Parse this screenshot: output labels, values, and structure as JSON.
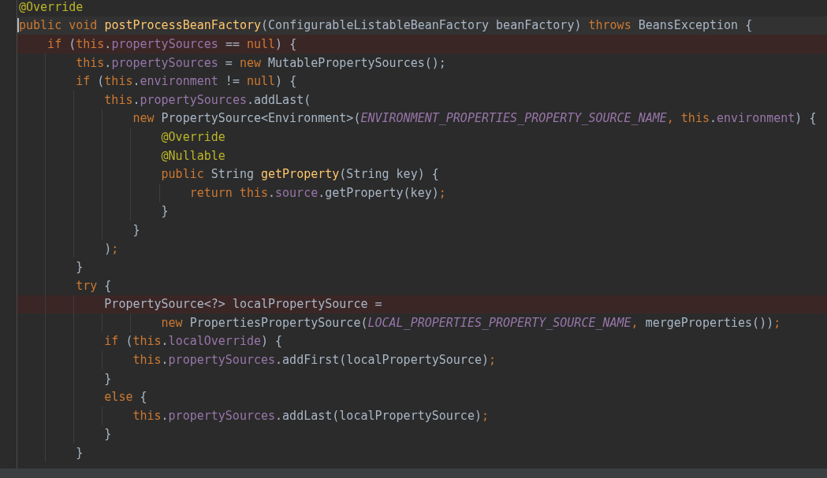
{
  "editor": {
    "lines": [
      {
        "kind": "normal",
        "tokens": [
          {
            "kind": "annotation",
            "text": "@Override"
          }
        ]
      },
      {
        "kind": "current",
        "tokens": [
          {
            "kind": "keyword",
            "text": "public void "
          },
          {
            "kind": "method",
            "text": "postProcessBeanFactory"
          },
          {
            "kind": "plain",
            "text": "(ConfigurableListableBeanFactory beanFactory) "
          },
          {
            "kind": "keyword",
            "text": "throws "
          },
          {
            "kind": "plain",
            "text": "BeansException {"
          }
        ]
      },
      {
        "kind": "marked",
        "tokens": [
          {
            "kind": "keyword",
            "text": "    if "
          },
          {
            "kind": "plain",
            "text": "("
          },
          {
            "kind": "keyword",
            "text": "this"
          },
          {
            "kind": "plain",
            "text": "."
          },
          {
            "kind": "field",
            "text": "propertySources"
          },
          {
            "kind": "plain",
            "text": " == "
          },
          {
            "kind": "keyword",
            "text": "null"
          },
          {
            "kind": "plain",
            "text": ") {"
          }
        ]
      },
      {
        "kind": "normal",
        "tokens": [
          {
            "kind": "keyword",
            "text": "        this"
          },
          {
            "kind": "plain",
            "text": "."
          },
          {
            "kind": "field",
            "text": "propertySources"
          },
          {
            "kind": "plain",
            "text": " = "
          },
          {
            "kind": "keyword",
            "text": "new "
          },
          {
            "kind": "plain",
            "text": "MutablePropertySources();"
          }
        ]
      },
      {
        "kind": "normal",
        "tokens": [
          {
            "kind": "keyword",
            "text": "        if "
          },
          {
            "kind": "plain",
            "text": "("
          },
          {
            "kind": "keyword",
            "text": "this"
          },
          {
            "kind": "plain",
            "text": "."
          },
          {
            "kind": "field",
            "text": "environment"
          },
          {
            "kind": "plain",
            "text": " != "
          },
          {
            "kind": "keyword",
            "text": "null"
          },
          {
            "kind": "plain",
            "text": ") {"
          }
        ]
      },
      {
        "kind": "normal",
        "tokens": [
          {
            "kind": "keyword",
            "text": "            this"
          },
          {
            "kind": "plain",
            "text": "."
          },
          {
            "kind": "field",
            "text": "propertySources"
          },
          {
            "kind": "plain",
            "text": ".addLast("
          }
        ]
      },
      {
        "kind": "normal",
        "tokens": [
          {
            "kind": "keyword",
            "text": "                new "
          },
          {
            "kind": "plain",
            "text": "PropertySource<Environment>("
          },
          {
            "kind": "constant",
            "text": "ENVIRONMENT_PROPERTIES_PROPERTY_SOURCE_NAME"
          },
          {
            "kind": "keyword",
            "text": ", this"
          },
          {
            "kind": "plain",
            "text": "."
          },
          {
            "kind": "field",
            "text": "environment"
          },
          {
            "kind": "plain",
            "text": ") {"
          }
        ]
      },
      {
        "kind": "normal",
        "tokens": [
          {
            "kind": "annotation",
            "text": "                    @Override"
          }
        ]
      },
      {
        "kind": "normal",
        "tokens": [
          {
            "kind": "annotation",
            "text": "                    @Nullable"
          }
        ]
      },
      {
        "kind": "normal",
        "tokens": [
          {
            "kind": "keyword",
            "text": "                    public "
          },
          {
            "kind": "plain",
            "text": "String "
          },
          {
            "kind": "method",
            "text": "getProperty"
          },
          {
            "kind": "plain",
            "text": "(String key) {"
          }
        ]
      },
      {
        "kind": "normal",
        "tokens": [
          {
            "kind": "keyword",
            "text": "                        return this"
          },
          {
            "kind": "plain",
            "text": "."
          },
          {
            "kind": "field",
            "text": "source"
          },
          {
            "kind": "plain",
            "text": ".getProperty(key)"
          },
          {
            "kind": "keyword",
            "text": ";"
          }
        ]
      },
      {
        "kind": "normal",
        "tokens": [
          {
            "kind": "plain",
            "text": "                    }"
          }
        ]
      },
      {
        "kind": "normal",
        "tokens": [
          {
            "kind": "plain",
            "text": "                }"
          }
        ]
      },
      {
        "kind": "normal",
        "tokens": [
          {
            "kind": "plain",
            "text": "            )"
          },
          {
            "kind": "keyword",
            "text": ";"
          }
        ]
      },
      {
        "kind": "normal",
        "tokens": [
          {
            "kind": "plain",
            "text": "        }"
          }
        ]
      },
      {
        "kind": "normal",
        "tokens": [
          {
            "kind": "keyword",
            "text": "        try "
          },
          {
            "kind": "plain",
            "text": "{"
          }
        ]
      },
      {
        "kind": "marked",
        "tokens": [
          {
            "kind": "plain",
            "text": "            PropertySource<?> localPropertySource ="
          }
        ]
      },
      {
        "kind": "normal",
        "tokens": [
          {
            "kind": "keyword",
            "text": "                    new "
          },
          {
            "kind": "plain",
            "text": "PropertiesPropertySource("
          },
          {
            "kind": "constant",
            "text": "LOCAL_PROPERTIES_PROPERTY_SOURCE_NAME"
          },
          {
            "kind": "keyword",
            "text": ", "
          },
          {
            "kind": "plain",
            "text": "mergeProperties())"
          },
          {
            "kind": "keyword",
            "text": ";"
          }
        ]
      },
      {
        "kind": "normal",
        "tokens": [
          {
            "kind": "keyword",
            "text": "            if "
          },
          {
            "kind": "plain",
            "text": "("
          },
          {
            "kind": "keyword",
            "text": "this"
          },
          {
            "kind": "plain",
            "text": "."
          },
          {
            "kind": "field",
            "text": "localOverride"
          },
          {
            "kind": "plain",
            "text": ") {"
          }
        ]
      },
      {
        "kind": "normal",
        "tokens": [
          {
            "kind": "keyword",
            "text": "                this"
          },
          {
            "kind": "plain",
            "text": "."
          },
          {
            "kind": "field",
            "text": "propertySources"
          },
          {
            "kind": "plain",
            "text": ".addFirst(localPropertySource)"
          },
          {
            "kind": "keyword",
            "text": ";"
          }
        ]
      },
      {
        "kind": "normal",
        "tokens": [
          {
            "kind": "plain",
            "text": "            }"
          }
        ]
      },
      {
        "kind": "normal",
        "tokens": [
          {
            "kind": "keyword",
            "text": "            else "
          },
          {
            "kind": "plain",
            "text": "{"
          }
        ]
      },
      {
        "kind": "normal",
        "tokens": [
          {
            "kind": "keyword",
            "text": "                this"
          },
          {
            "kind": "plain",
            "text": "."
          },
          {
            "kind": "field",
            "text": "propertySources"
          },
          {
            "kind": "plain",
            "text": ".addLast(localPropertySource)"
          },
          {
            "kind": "keyword",
            "text": ";"
          }
        ]
      },
      {
        "kind": "normal",
        "tokens": [
          {
            "kind": "plain",
            "text": "            }"
          }
        ]
      },
      {
        "kind": "normal",
        "tokens": [
          {
            "kind": "plain",
            "text": "        }"
          }
        ]
      }
    ]
  }
}
